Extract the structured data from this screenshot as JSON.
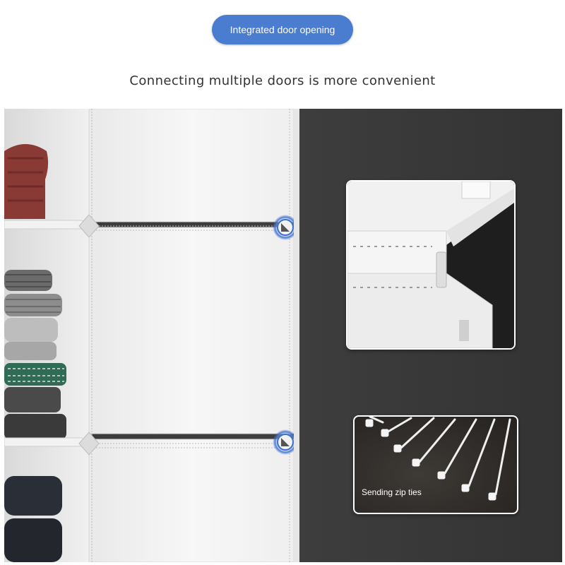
{
  "badge": {
    "label": "Integrated door opening",
    "color": "#4a7ccf"
  },
  "headline": "Connecting multiple doors is more convenient",
  "inset_zip_ties": {
    "label": "Sending zip ties"
  },
  "colors": {
    "background_dark": "#3a3a3a",
    "panel": "#f4f4f4",
    "connector_ring": "#3c6fcf"
  }
}
